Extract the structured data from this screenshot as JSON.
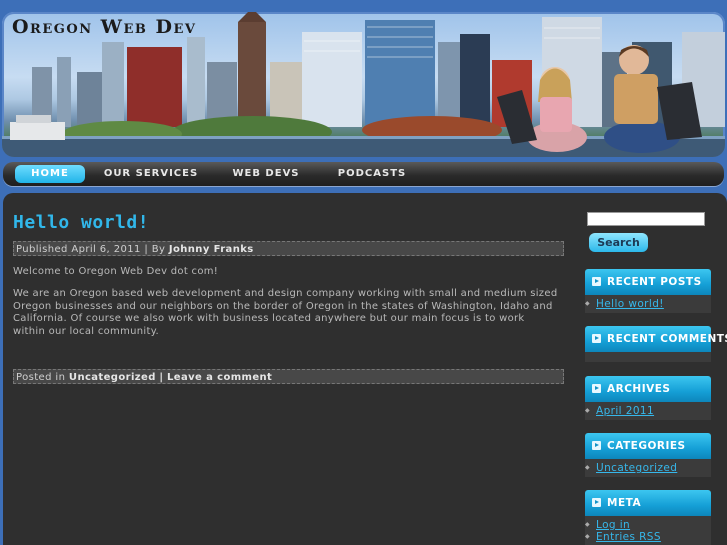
{
  "site": {
    "title": "Oregon Web Dev"
  },
  "nav": [
    {
      "label": "HOME"
    },
    {
      "label": "OUR SERVICES"
    },
    {
      "label": "WEB DEVS"
    },
    {
      "label": "PODCASTS"
    }
  ],
  "post": {
    "title": "Hello world!",
    "meta_published_prefix": "Published",
    "meta_date": "April 6, 2011",
    "meta_by": "| By",
    "meta_author": "Johnny Franks",
    "paragraphs": [
      "Welcome to Oregon Web Dev dot com!",
      "We are an Oregon based web development and design company working with small and medium sized Oregon businesses and our neighbors on the border of Oregon in the states of Washington, Idaho and California. Of course we also work with business located anywhere but our main focus is to work within our local community."
    ],
    "footer_prefix": "Posted in",
    "footer_category": "Uncategorized",
    "footer_sep": "|",
    "footer_comment": "Leave a comment"
  },
  "sidebar": {
    "search_value": "",
    "search_label": "Search",
    "widgets": [
      {
        "title": "RECENT POSTS",
        "links": [
          "Hello world!"
        ]
      },
      {
        "title": "RECENT COMMENTS",
        "links": []
      },
      {
        "title": "ARCHIVES",
        "links": [
          "April 2011"
        ]
      },
      {
        "title": "CATEGORIES",
        "links": [
          "Uncategorized"
        ]
      },
      {
        "title": "META",
        "links": [
          "Log in",
          "Entries RSS"
        ]
      }
    ]
  },
  "colors": {
    "accent": "#31b7ea",
    "page_bg": "#3d6fb8",
    "panel_bg": "#2f2f2f"
  }
}
